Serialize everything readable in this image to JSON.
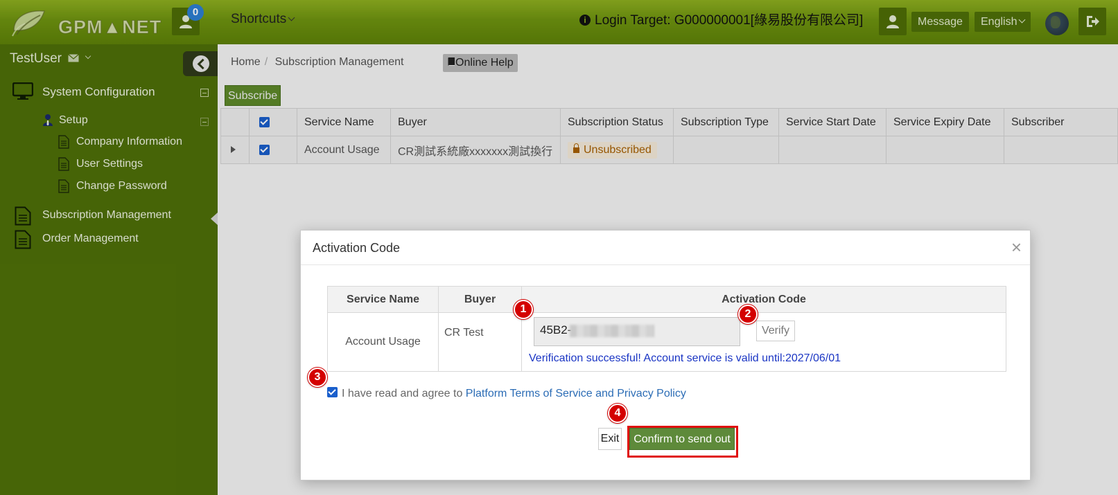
{
  "header": {
    "logo_text": "GPM▲NET",
    "notification_count": "0",
    "shortcuts_label": "Shortcuts",
    "login_target": "Login Target: G000000001[綠易股份有限公司]",
    "message_label": "Message",
    "language_label": "English"
  },
  "sidebar": {
    "user_name": "TestUser",
    "items": [
      {
        "label": "System Configuration",
        "icon": "monitor-icon"
      },
      {
        "label": "Setup",
        "icon": "user-tie-icon"
      },
      {
        "label": "Company Information",
        "icon": "document-icon"
      },
      {
        "label": "User Settings",
        "icon": "document-icon"
      },
      {
        "label": "Change Password",
        "icon": "document-icon"
      },
      {
        "label": "Subscription Management",
        "icon": "document-icon"
      },
      {
        "label": "Order Management",
        "icon": "document-icon"
      }
    ]
  },
  "main": {
    "breadcrumb": [
      "Home",
      "Subscription Management"
    ],
    "online_help_label": "Online Help",
    "subscribe_label": "Subscribe",
    "table": {
      "columns": [
        "Service Name",
        "Buyer",
        "Subscription Status",
        "Subscription Type",
        "Service Start Date",
        "Service Expiry Date",
        "Subscriber"
      ],
      "rows": [
        {
          "service_name": "Account Usage",
          "buyer": "CR測試系統廠xxxxxxx測試換行",
          "status": "Unsubscribed",
          "type": "",
          "start_date": "",
          "expiry_date": "",
          "subscriber": ""
        }
      ]
    }
  },
  "modal": {
    "title": "Activation Code",
    "close_symbol": "×",
    "columns": [
      "Service Name",
      "Buyer",
      "Activation Code"
    ],
    "row": {
      "service_name": "Account Usage",
      "buyer": "CR Test",
      "activation_code_visible": "45B2-"
    },
    "verify_label": "Verify",
    "verify_message": "Verification successful! Account service is valid until:2027/06/01",
    "agree_text": "I have read and agree to ",
    "agree_link": "Platform Terms of Service and Privacy Policy",
    "exit_label": "Exit",
    "confirm_label": "Confirm to send out",
    "steps": [
      "1",
      "2",
      "3",
      "4"
    ],
    "colors": {
      "step_marker": "#d40000",
      "highlight_box": "#e01010",
      "confirm_button": "#5e8a3a",
      "verify_message": "#1a35c4"
    }
  }
}
